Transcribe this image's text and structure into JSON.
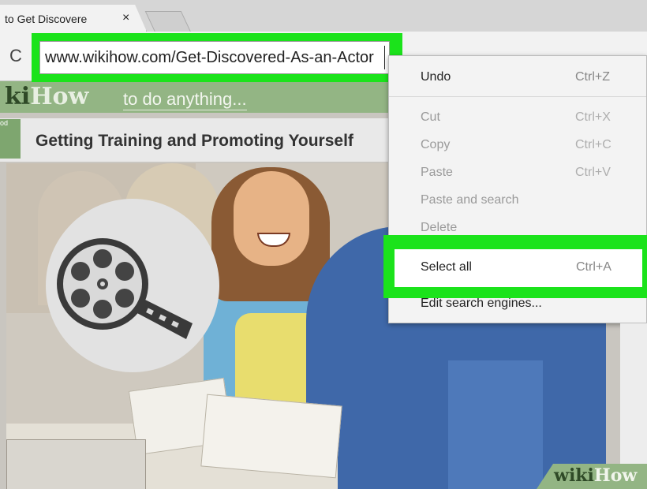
{
  "browser": {
    "tab_title": "to Get Discovere",
    "tab_close": "×",
    "url": "www.wikihow.com/Get-Discovered-As-an-Actor",
    "reload_glyph": "C"
  },
  "page": {
    "logo_wiki": "ki",
    "logo_how": "How",
    "tagline": "to do anything...",
    "badge": "od",
    "section_title": "Getting Training and Promoting Yourself"
  },
  "context_menu": {
    "items": [
      {
        "label": "Undo",
        "shortcut": "Ctrl+Z",
        "enabled": true
      },
      {
        "label": "Cut",
        "shortcut": "Ctrl+X",
        "enabled": false
      },
      {
        "label": "Copy",
        "shortcut": "Ctrl+C",
        "enabled": false
      },
      {
        "label": "Paste",
        "shortcut": "Ctrl+V",
        "enabled": false
      },
      {
        "label": "Paste and search",
        "shortcut": "",
        "enabled": false
      },
      {
        "label": "Delete",
        "shortcut": "",
        "enabled": false
      },
      {
        "label": "Select all",
        "shortcut": "Ctrl+A",
        "enabled": true
      },
      {
        "label": "Edit search engines...",
        "shortcut": "",
        "enabled": true
      }
    ]
  },
  "watermark": {
    "wiki": "wiki",
    "how": "How"
  },
  "colors": {
    "highlight": "#1be31b",
    "wikihow_green": "#93b584"
  }
}
